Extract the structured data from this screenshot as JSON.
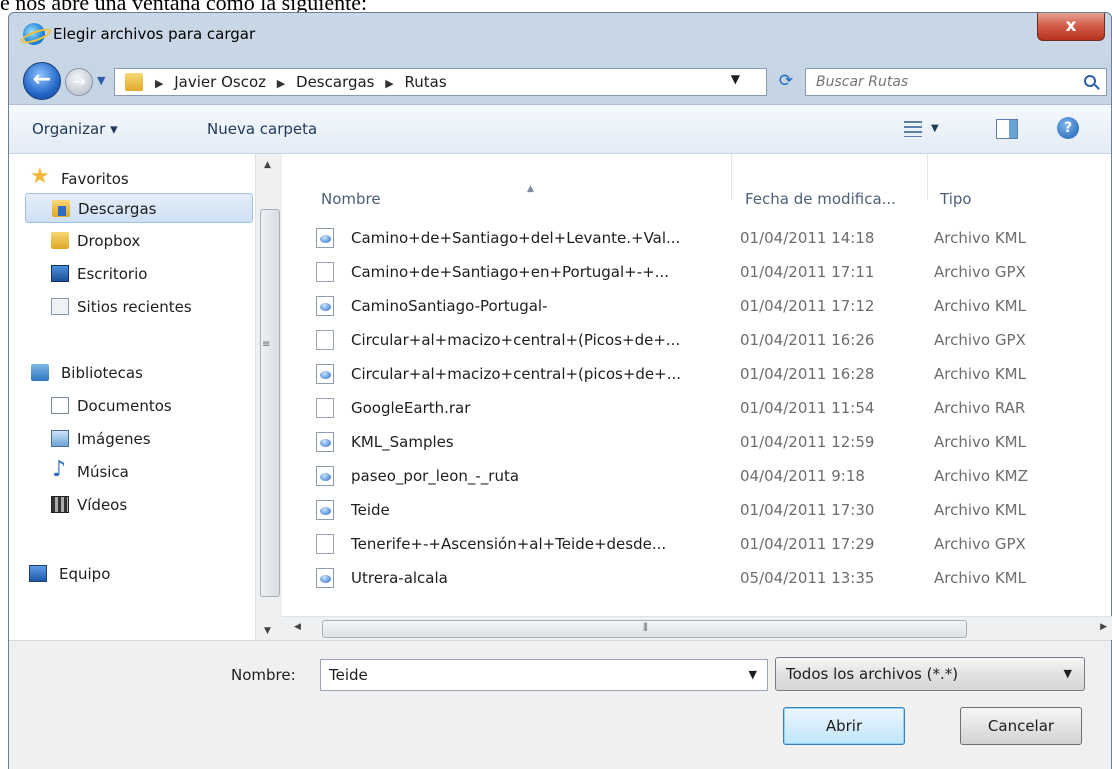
{
  "caption": "e nos abre una ventana como la siguiente:",
  "window": {
    "title": "Elegir archivos para cargar",
    "close_glyph": "x"
  },
  "address": {
    "crumbs": [
      "Javier Oscoz",
      "Descargas",
      "Rutas"
    ],
    "search_placeholder": "Buscar Rutas"
  },
  "toolbar": {
    "organize": "Organizar ▾",
    "new_folder": "Nueva carpeta"
  },
  "nav": {
    "favorites": "Favoritos",
    "downloads": "Descargas",
    "dropbox": "Dropbox",
    "desktop": "Escritorio",
    "recent": "Sitios recientes",
    "libraries": "Bibliotecas",
    "documents": "Documentos",
    "images": "Imágenes",
    "music": "Música",
    "videos": "Vídeos",
    "computer": "Equipo"
  },
  "columns": {
    "name": "Nombre",
    "date": "Fecha de modifica...",
    "type": "Tipo"
  },
  "files": [
    {
      "name": "Camino+de+Santiago+del+Levante.+Val...",
      "date": "01/04/2011 14:18",
      "type": "Archivo KML",
      "icon": "kml"
    },
    {
      "name": "Camino+de+Santiago+en+Portugal+-+...",
      "date": "01/04/2011 17:11",
      "type": "Archivo GPX",
      "icon": "doc"
    },
    {
      "name": "CaminoSantiago-Portugal-",
      "date": "01/04/2011 17:12",
      "type": "Archivo KML",
      "icon": "kml"
    },
    {
      "name": "Circular+al+macizo+central+(Picos+de+...",
      "date": "01/04/2011 16:26",
      "type": "Archivo GPX",
      "icon": "doc"
    },
    {
      "name": "Circular+al+macizo+central+(picos+de+...",
      "date": "01/04/2011 16:28",
      "type": "Archivo KML",
      "icon": "kml"
    },
    {
      "name": "GoogleEarth.rar",
      "date": "01/04/2011 11:54",
      "type": "Archivo RAR",
      "icon": "doc"
    },
    {
      "name": "KML_Samples",
      "date": "01/04/2011 12:59",
      "type": "Archivo KML",
      "icon": "kml"
    },
    {
      "name": "paseo_por_leon_-_ruta",
      "date": "04/04/2011 9:18",
      "type": "Archivo KMZ",
      "icon": "kml"
    },
    {
      "name": "Teide",
      "date": "01/04/2011 17:30",
      "type": "Archivo KML",
      "icon": "kml"
    },
    {
      "name": "Tenerife+-+Ascensión+al+Teide+desde...",
      "date": "01/04/2011 17:29",
      "type": "Archivo GPX",
      "icon": "doc"
    },
    {
      "name": "Utrera-alcala",
      "date": "05/04/2011 13:35",
      "type": "Archivo KML",
      "icon": "kml"
    }
  ],
  "bottom": {
    "name_label": "Nombre:",
    "name_value": "Teide",
    "filter": "Todos los archivos (*.*)",
    "open": "Abrir",
    "cancel": "Cancelar"
  },
  "colors": {
    "accent": "#2a5ea6",
    "selection": "#cfe0f4",
    "close": "#d25a45"
  }
}
